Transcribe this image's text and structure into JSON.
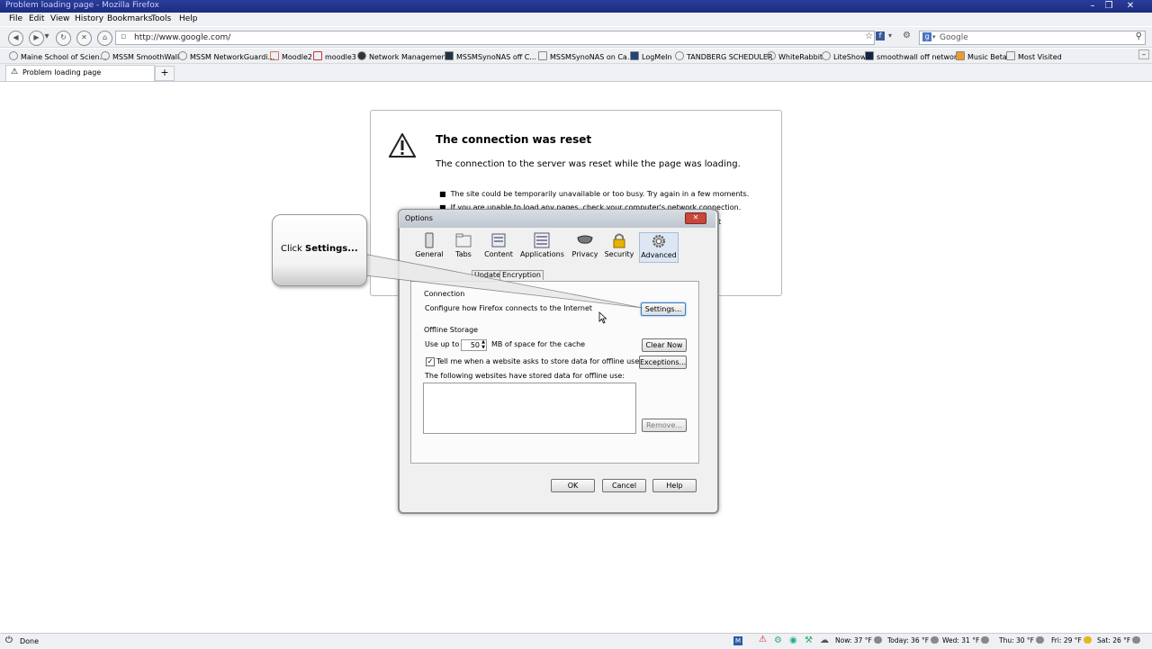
{
  "window": {
    "title": "Problem loading page - Mozilla Firefox"
  },
  "menu": [
    "File",
    "Edit",
    "View",
    "History",
    "Bookmarks",
    "Tools",
    "Help"
  ],
  "nav": {
    "url": "http://www.google.com/",
    "search_engine": "Google"
  },
  "bookmarks": [
    "Maine School of Scien...",
    "MSSM SmoothWall",
    "MSSM NetworkGuardi...",
    "Moodle2",
    "moodle3",
    "Network Management",
    "MSSMSynoNAS off C...",
    "MSSMSynoNAS on Ca...",
    "LogMeIn",
    "TANDBERG SCHEDULER",
    "WhiteRabbit",
    "LiteShow",
    "smoothwall off network",
    "Music Beta",
    "Most Visited"
  ],
  "tab": {
    "label": "Problem loading page",
    "new_tab": "+"
  },
  "error": {
    "title": "The connection was reset",
    "description": "The connection to the server was reset while the page was loading.",
    "bullets": [
      "The site could be temporarily unavailable or too busy. Try again in a few moments.",
      "If you are unable to load any pages, check your computer's network connection.",
      "hat"
    ]
  },
  "callout": {
    "text_prefix": "Click ",
    "text_bold": "Settings..."
  },
  "dialog": {
    "title": "Options",
    "panes": [
      "General",
      "Tabs",
      "Content",
      "Applications",
      "Privacy",
      "Security",
      "Advanced"
    ],
    "subtabs": [
      "Update",
      "Encryption"
    ],
    "connection_heading": "Connection",
    "connection_desc": "Configure how Firefox connects to the Internet",
    "settings_button": "Settings...",
    "offline_heading": "Offline Storage",
    "use_up_to": "Use up to",
    "cache_value": "50",
    "cache_suffix": "MB of space for the cache",
    "clear_now": "Clear Now",
    "tell_me": "Tell me when a website asks to store data for offline use",
    "exceptions": "Exceptions...",
    "stored_label": "The following websites have stored data for offline use:",
    "remove": "Remove...",
    "ok": "OK",
    "cancel": "Cancel",
    "help": "Help"
  },
  "status": {
    "text": "Done",
    "weather": [
      "Now: 37 °F",
      "Today: 36 °F",
      "Wed: 31 °F",
      "Thu: 30 °F",
      "Fri: 29 °F",
      "Sat: 26 °F"
    ]
  },
  "colors": {
    "titlebar": "#1d2c80",
    "close_button": "#c9473a",
    "selected_pane": "#dce7f3"
  }
}
